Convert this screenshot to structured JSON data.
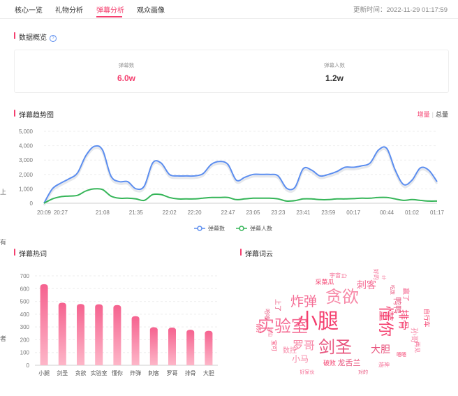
{
  "tabs": [
    {
      "label": "核心一览",
      "active": false
    },
    {
      "label": "礼物分析",
      "active": false
    },
    {
      "label": "弹幕分析",
      "active": true
    },
    {
      "label": "观众画像",
      "active": false
    }
  ],
  "update_time": "更新时间：2022-11-29 01:17:59",
  "overview": {
    "title": "数据概览",
    "help_icon": "question-circle-icon",
    "metrics": [
      {
        "label": "弹幕数",
        "value": "6.0w",
        "color": "#f43f6e"
      },
      {
        "label": "弹幕人数",
        "value": "1.2w",
        "color": "#333333"
      }
    ]
  },
  "trend": {
    "title": "弹幕趋势图",
    "toggle": {
      "active": "增量",
      "inactive": "总量"
    }
  },
  "hot_words": {
    "title": "弹幕热词"
  },
  "word_cloud": {
    "title": "弹幕词云",
    "words": [
      "小腿",
      "实验室",
      "贪欲",
      "剑圣",
      "懂你",
      "炸弹",
      "罗哥",
      "大胆",
      "排骨",
      "刺客",
      "小马",
      "龙舌兰",
      "破败",
      "赢了",
      "孙哥",
      "鸭鸭",
      "自行车",
      "游神",
      "数控",
      "上了",
      "采菜瓜",
      "宇宙",
      "白",
      "哈哈",
      "宝可",
      "好的",
      "牛",
      "吃饭",
      "嗯嗯",
      "再见",
      "加油",
      "对的",
      "你好",
      "好家伙"
    ]
  },
  "edge_glyphs": [
    "上",
    "有",
    "者"
  ],
  "chart_data": [
    {
      "type": "line",
      "title": "",
      "x": [
        "20:09",
        "20:18",
        "20:27",
        "20:36",
        "20:45",
        "20:54",
        "21:03",
        "21:08",
        "21:13",
        "21:22",
        "21:31",
        "21:35",
        "21:40",
        "21:49",
        "21:58",
        "22:02",
        "22:07",
        "22:16",
        "22:20",
        "22:25",
        "22:34",
        "22:43",
        "22:47",
        "22:52",
        "23:01",
        "23:05",
        "23:10",
        "23:19",
        "23:23",
        "23:28",
        "23:37",
        "23:41",
        "23:46",
        "23:55",
        "23:59",
        "00:04",
        "00:13",
        "00:17",
        "00:22",
        "00:31",
        "00:40",
        "00:44",
        "00:49",
        "00:58",
        "01:02",
        "01:07",
        "01:13",
        "01:17"
      ],
      "xticks": [
        "20:09",
        "20:27",
        "21:08",
        "21:35",
        "22:02",
        "22:20",
        "22:47",
        "23:05",
        "23:23",
        "23:41",
        "23:59",
        "00:17",
        "00:44",
        "01:02",
        "01:17"
      ],
      "yticks": [
        "0",
        "1,000",
        "2,000",
        "3,000",
        "4,000",
        "5,000"
      ],
      "ylim": [
        0,
        5000
      ],
      "legend_position": "bottom",
      "series": [
        {
          "name": "弹幕数",
          "color": "#5b8def",
          "values": [
            0,
            1000,
            1400,
            1700,
            2100,
            3300,
            3950,
            3700,
            1900,
            1500,
            1500,
            1000,
            1200,
            2800,
            2800,
            2000,
            1900,
            1900,
            1900,
            2050,
            2700,
            2900,
            2700,
            1600,
            1800,
            2000,
            2000,
            2000,
            1900,
            1050,
            1100,
            2400,
            2300,
            1900,
            2000,
            2200,
            2500,
            2500,
            2600,
            2800,
            3700,
            3800,
            2300,
            1300,
            1600,
            2450,
            2300,
            1500
          ]
        },
        {
          "name": "弹幕人数",
          "color": "#35b558",
          "values": [
            0,
            300,
            450,
            500,
            550,
            850,
            1000,
            950,
            500,
            350,
            350,
            300,
            200,
            600,
            600,
            400,
            300,
            300,
            300,
            350,
            400,
            400,
            400,
            250,
            300,
            350,
            350,
            350,
            300,
            150,
            180,
            300,
            300,
            250,
            250,
            300,
            300,
            320,
            350,
            350,
            400,
            400,
            300,
            200,
            250,
            200,
            150,
            150
          ]
        }
      ]
    },
    {
      "type": "bar",
      "title": "",
      "categories": [
        "小腿",
        "剑圣",
        "贪欲",
        "实验室",
        "懂你",
        "炸弹",
        "刺客",
        "罗哥",
        "排骨",
        "大胆"
      ],
      "values": [
        635,
        490,
        480,
        478,
        472,
        385,
        298,
        295,
        278,
        270
      ],
      "yticks": [
        "0",
        "100",
        "200",
        "300",
        "400",
        "500",
        "600",
        "700"
      ],
      "ylim": [
        0,
        700
      ],
      "color_top": "#f5628f",
      "color_bottom": "#fdb6c8"
    }
  ]
}
